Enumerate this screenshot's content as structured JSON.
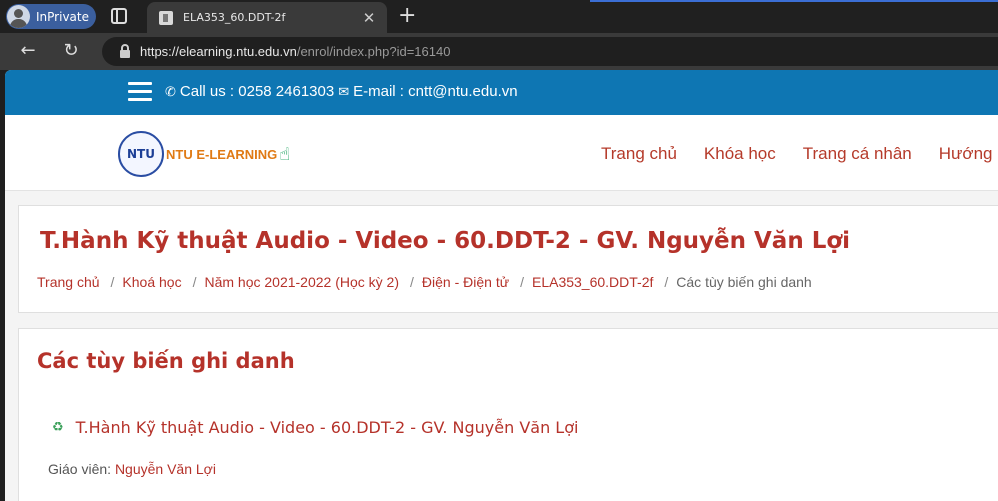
{
  "browser": {
    "profile_label": "InPrivate",
    "tab_title": "ELA353_60.DDT-2f",
    "close_glyph": "✕",
    "new_tab_glyph": "+",
    "back_glyph": "←",
    "reload_glyph": "↻",
    "url_host": "https://elearning.ntu.edu.vn",
    "url_rest": "/enrol/index.php?id=16140"
  },
  "topbar": {
    "phone_icon": "phone-icon",
    "phone_text": "Call us : 0258 2461303",
    "mail_icon": "mail-icon",
    "email_text": "E-mail : cntt@ntu.edu.vn"
  },
  "header": {
    "logo_abbrev": "NTU",
    "logo_text": "NTU E-LEARNING",
    "nav": [
      "Trang chủ",
      "Khóa học",
      "Trang cá nhân",
      "Hướng"
    ]
  },
  "course": {
    "title": "T.Hành Kỹ thuật Audio - Video - 60.DDT-2 - GV. Nguyễn Văn Lợi",
    "breadcrumb": [
      "Trang chủ",
      "Khoá học",
      "Năm học 2021-2022 (Học kỳ 2)",
      "Điện - Điện tử",
      "ELA353_60.DDT-2f",
      "Các tùy biến ghi danh"
    ],
    "breadcrumb_sep": "/"
  },
  "enrol": {
    "section_title": "Các tùy biến ghi danh",
    "course_link": "T.Hành Kỹ thuật Audio - Video - 60.DDT-2 - GV. Nguyễn Văn Lợi",
    "teacher_label": "Giáo viên:",
    "teacher_name": "Nguyễn Văn Lợi"
  },
  "colors": {
    "topbar": "#0e76b3",
    "link": "#b5322a"
  }
}
